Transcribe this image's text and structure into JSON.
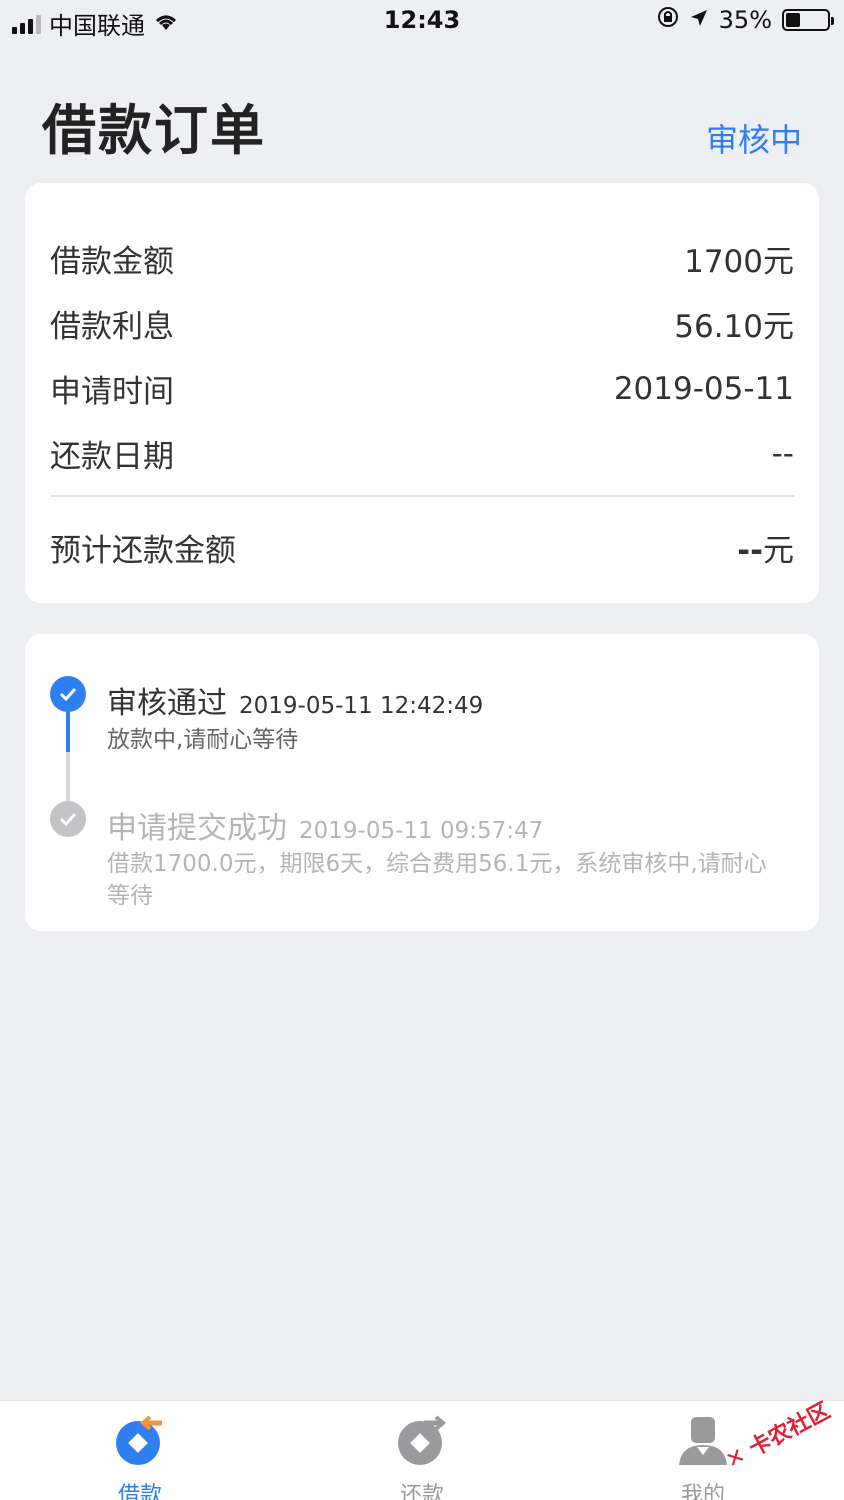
{
  "status_bar": {
    "carrier": "中国联通",
    "time": "12:43",
    "battery": "35%",
    "battery_level": 0.35
  },
  "header": {
    "title": "借款订单",
    "status": "审核中"
  },
  "info_card": {
    "rows": [
      {
        "label": "借款金额",
        "value": "1700元"
      },
      {
        "label": "借款利息",
        "value": "56.10元"
      },
      {
        "label": "申请时间",
        "value": "2019-05-11"
      },
      {
        "label": "还款日期",
        "value": "--"
      }
    ],
    "total_label": "预计还款金额",
    "total_dash": "--",
    "total_unit": "元"
  },
  "timeline": [
    {
      "title": "审核通过",
      "time": "2019-05-11 12:42:49",
      "desc": "放款中,请耐心等待",
      "color": "#2f7ff0"
    },
    {
      "title": "申请提交成功",
      "time": "2019-05-11 09:57:47",
      "desc_line1": "借款1700.0元，期限6天，综合费用56.1元，系统审核中,请耐心",
      "desc_line2": "等待",
      "color": "#b5b5b8"
    }
  ],
  "tab_bar": {
    "items": [
      {
        "label": "借款",
        "icon": "loan-icon",
        "active": true
      },
      {
        "label": "还款",
        "icon": "repay-icon",
        "active": false
      },
      {
        "label": "我的",
        "icon": "profile-icon",
        "active": false
      }
    ],
    "active_color": "#2f7ff0",
    "inactive_color": "#9a9a9d"
  },
  "watermark": "卡农社区"
}
